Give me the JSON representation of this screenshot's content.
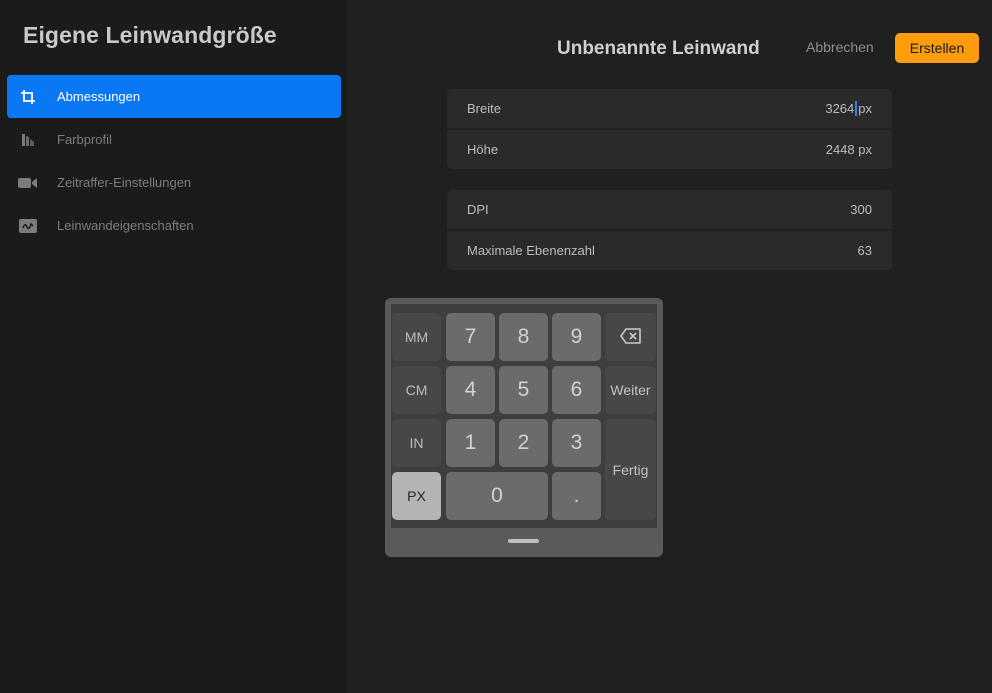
{
  "sidebar": {
    "title": "Eigene Leinwandgröße",
    "items": [
      {
        "label": "Abmessungen",
        "icon": "crop-icon",
        "active": true
      },
      {
        "label": "Farbprofil",
        "icon": "color-profile-icon",
        "active": false
      },
      {
        "label": "Zeitraffer-Einstellungen",
        "icon": "video-camera-icon",
        "active": false
      },
      {
        "label": "Leinwandeigenschaften",
        "icon": "canvas-properties-icon",
        "active": false
      }
    ]
  },
  "header": {
    "title": "Unbenannte Leinwand",
    "cancel_label": "Abbrechen",
    "create_label": "Erstellen"
  },
  "fields": {
    "width": {
      "label": "Breite",
      "value": "3264",
      "unit": "px"
    },
    "height": {
      "label": "Höhe",
      "value": "2448",
      "unit": "px"
    },
    "dpi": {
      "label": "DPI",
      "value": "300"
    },
    "max_layers": {
      "label": "Maximale Ebenenzahl",
      "value": "63"
    }
  },
  "keypad": {
    "units": [
      "MM",
      "CM",
      "IN",
      "PX"
    ],
    "selected_unit": "PX",
    "digits": [
      "7",
      "8",
      "9",
      "4",
      "5",
      "6",
      "1",
      "2",
      "3",
      "0",
      "."
    ],
    "next_label": "Weiter",
    "done_label": "Fertig",
    "backspace_icon": "backspace-icon"
  },
  "colors": {
    "accent": "#0a78f5",
    "create_button": "#fd9d0e",
    "cursor": "#3a7cf0"
  }
}
